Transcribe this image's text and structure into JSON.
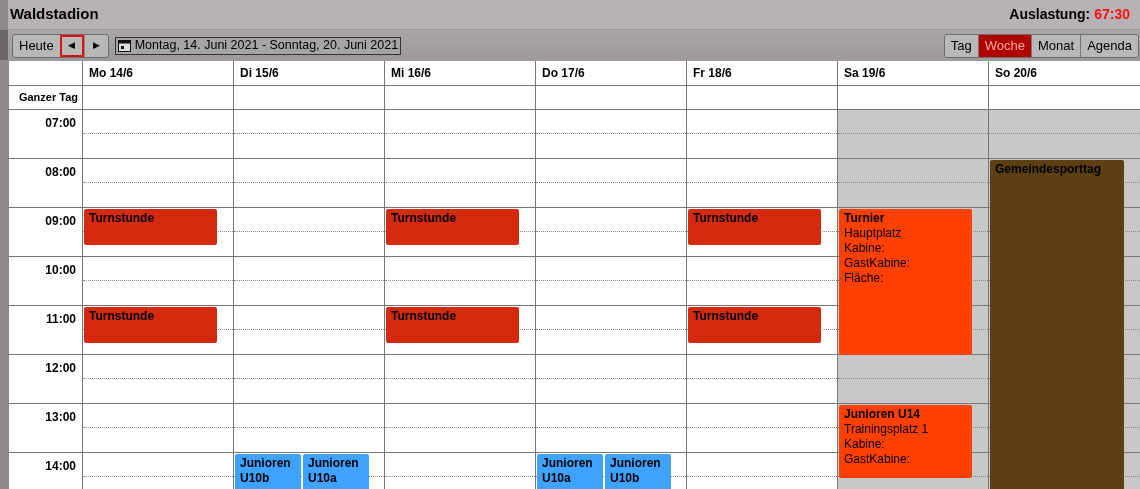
{
  "title": "Waldstadion",
  "utilization": {
    "label": "Auslastung:",
    "value": "67:30"
  },
  "toolbar": {
    "today": "Heute",
    "prev": {
      "label": "◀",
      "focused": true
    },
    "next": {
      "label": "▶",
      "focused": false
    },
    "range": "Montag, 14. Juni 2021 - Sonntag, 20. Juni 2021"
  },
  "views": [
    {
      "label": "Tag",
      "selected": false
    },
    {
      "label": "Woche",
      "selected": true
    },
    {
      "label": "Monat",
      "selected": false
    },
    {
      "label": "Agenda",
      "selected": false
    }
  ],
  "days": [
    "Mo 14/6",
    "Di 15/6",
    "Mi 16/6",
    "Do 17/6",
    "Fr 18/6",
    "Sa 19/6",
    "So 20/6"
  ],
  "all_day_label": "Ganzer Tag",
  "rows": [
    {
      "label": "07:00",
      "cells": [
        {
          "weekend": false
        },
        {
          "weekend": false
        },
        {
          "weekend": false
        },
        {
          "weekend": false
        },
        {
          "weekend": false
        },
        {
          "weekend": true
        },
        {
          "weekend": true
        }
      ]
    },
    {
      "label": "08:00",
      "cells": [
        {
          "weekend": false
        },
        {
          "weekend": false
        },
        {
          "weekend": false
        },
        {
          "weekend": false
        },
        {
          "weekend": false
        },
        {
          "weekend": true
        },
        {
          "weekend": true,
          "events": [
            {
              "title": "Gemeindesporttag",
              "kind": "festival",
              "color": "#5c4013"
            }
          ]
        }
      ]
    },
    {
      "label": "09:00",
      "cells": [
        {
          "weekend": false,
          "events": [
            {
              "title": "Turnstunde",
              "kind": "lesson",
              "color": "#d42a10"
            }
          ]
        },
        {
          "weekend": false
        },
        {
          "weekend": false,
          "events": [
            {
              "title": "Turnstunde",
              "kind": "lesson",
              "color": "#d42a10"
            }
          ]
        },
        {
          "weekend": false
        },
        {
          "weekend": false,
          "events": [
            {
              "title": "Turnstunde",
              "kind": "lesson",
              "color": "#d42a10"
            }
          ]
        },
        {
          "weekend": true,
          "events": [
            {
              "title": "Turnier",
              "kind": "tournament",
              "color": "#ff4000",
              "lines": [
                "Hauptplatz",
                "Kabine:",
                "GastKabine:",
                "Fläche:"
              ]
            }
          ]
        },
        {
          "weekend": true
        }
      ]
    },
    {
      "label": "10:00",
      "cells": [
        {
          "weekend": false
        },
        {
          "weekend": false
        },
        {
          "weekend": false
        },
        {
          "weekend": false
        },
        {
          "weekend": false
        },
        {
          "weekend": true
        },
        {
          "weekend": true
        }
      ]
    },
    {
      "label": "11:00",
      "cells": [
        {
          "weekend": false,
          "events": [
            {
              "title": "Turnstunde",
              "kind": "lesson",
              "color": "#d42a10"
            }
          ]
        },
        {
          "weekend": false
        },
        {
          "weekend": false,
          "events": [
            {
              "title": "Turnstunde",
              "kind": "lesson",
              "color": "#d42a10"
            }
          ]
        },
        {
          "weekend": false
        },
        {
          "weekend": false,
          "events": [
            {
              "title": "Turnstunde",
              "kind": "lesson",
              "color": "#d42a10"
            }
          ]
        },
        {
          "weekend": true
        },
        {
          "weekend": true
        }
      ]
    },
    {
      "label": "12:00",
      "cells": [
        {
          "weekend": false
        },
        {
          "weekend": false
        },
        {
          "weekend": false
        },
        {
          "weekend": false
        },
        {
          "weekend": false
        },
        {
          "weekend": true
        },
        {
          "weekend": true
        }
      ]
    },
    {
      "label": "13:00",
      "cells": [
        {
          "weekend": false
        },
        {
          "weekend": false
        },
        {
          "weekend": false
        },
        {
          "weekend": false
        },
        {
          "weekend": false
        },
        {
          "weekend": true,
          "events": [
            {
              "title": "Junioren U14",
              "kind": "training",
              "color": "#ff4000",
              "lines": [
                "Trainingsplatz 1",
                "Kabine:",
                "GastKabine:"
              ]
            }
          ]
        },
        {
          "weekend": true
        }
      ]
    },
    {
      "label": "14:00",
      "cells": [
        {
          "weekend": false
        },
        {
          "weekend": false,
          "events": [
            {
              "title": "Junioren U10b",
              "kind": "training",
              "color": "#3fa2ff"
            },
            {
              "title": "Junioren U10a",
              "kind": "training",
              "color": "#3fa2ff"
            }
          ]
        },
        {
          "weekend": false
        },
        {
          "weekend": false,
          "events": [
            {
              "title": "Junioren U10a",
              "kind": "training",
              "color": "#3fa2ff"
            },
            {
              "title": "Junioren U10b",
              "kind": "training",
              "color": "#3fa2ff"
            }
          ]
        },
        {
          "weekend": false
        },
        {
          "weekend": true
        },
        {
          "weekend": true
        }
      ]
    }
  ]
}
